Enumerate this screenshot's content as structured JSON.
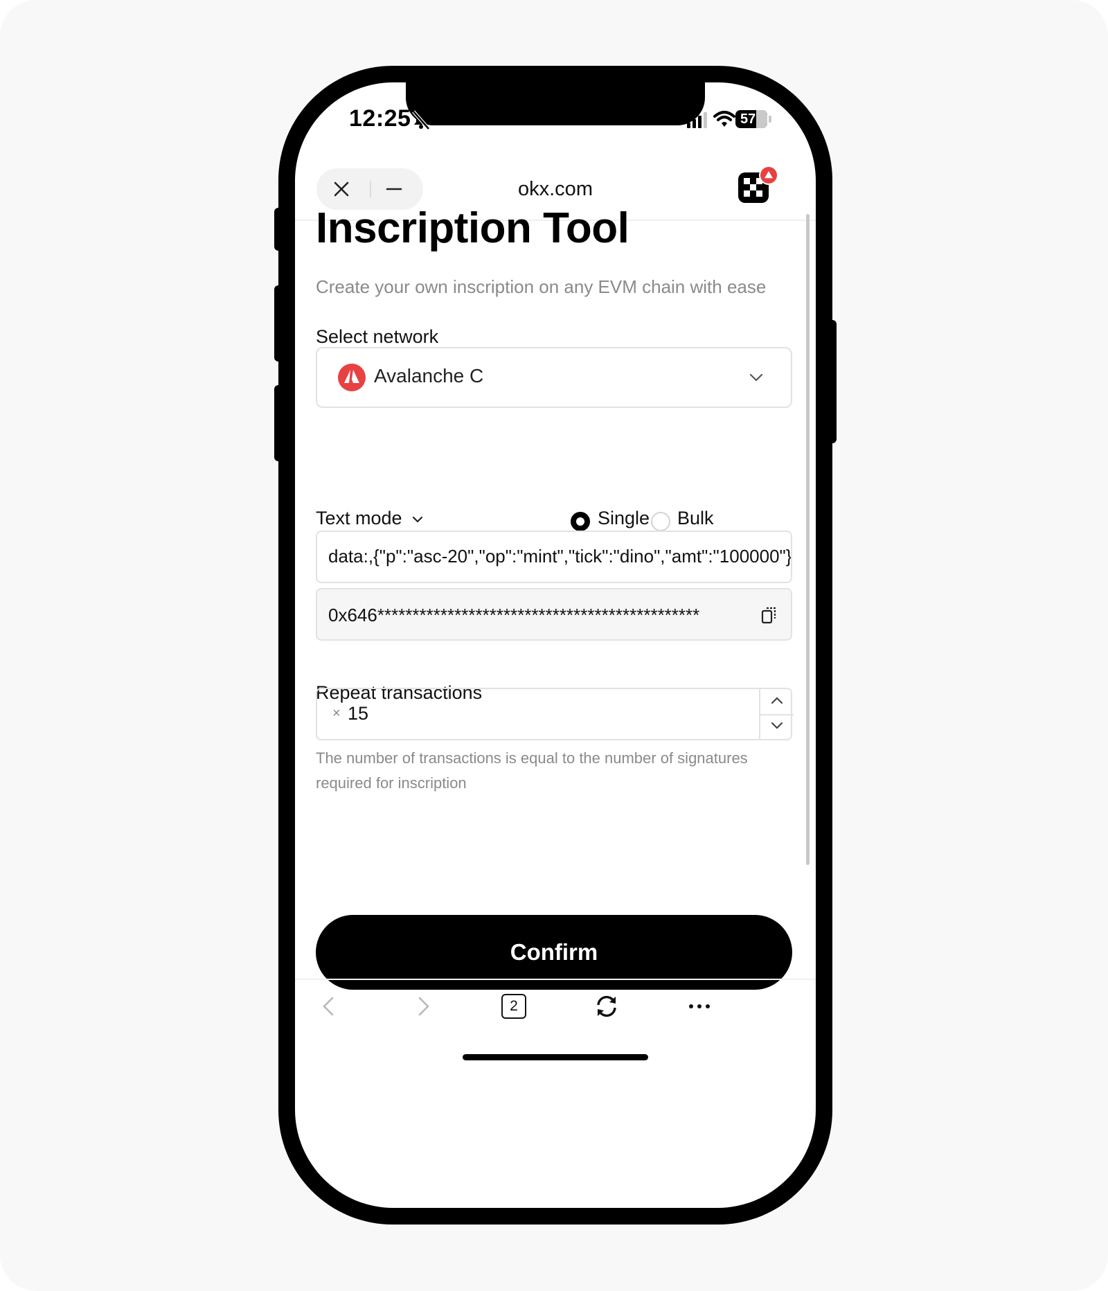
{
  "status": {
    "time": "12:25",
    "battery": "57"
  },
  "browser": {
    "url": "okx.com"
  },
  "page": {
    "title": "Inscription Tool",
    "subtitle": "Create your own inscription on any EVM chain with ease"
  },
  "network": {
    "label": "Select network",
    "value": "Avalanche C"
  },
  "mode": {
    "label": "Text mode",
    "options": [
      "Single",
      "Bulk"
    ],
    "selected": "Single"
  },
  "inscription_text": "data:,{\"p\":\"asc-20\",\"op\":\"mint\",\"tick\":\"dino\",\"amt\":\"100000\"}",
  "address": "0x646**********************************************",
  "repeat": {
    "label": "Repeat transactions",
    "prefix": "×",
    "value": "15",
    "help": "The number of transactions is equal to the number of signatures required for inscription"
  },
  "confirm_label": "Confirm",
  "tabs_count": "2",
  "colors": {
    "avalanche_red": "#e84142",
    "primary": "#000000"
  },
  "icons": [
    "close-icon",
    "minimize-icon",
    "okx-logo",
    "chevron-down-icon",
    "copy-icon",
    "chevron-up-icon",
    "back-icon",
    "forward-icon",
    "tabs-icon",
    "refresh-icon",
    "more-icon"
  ]
}
